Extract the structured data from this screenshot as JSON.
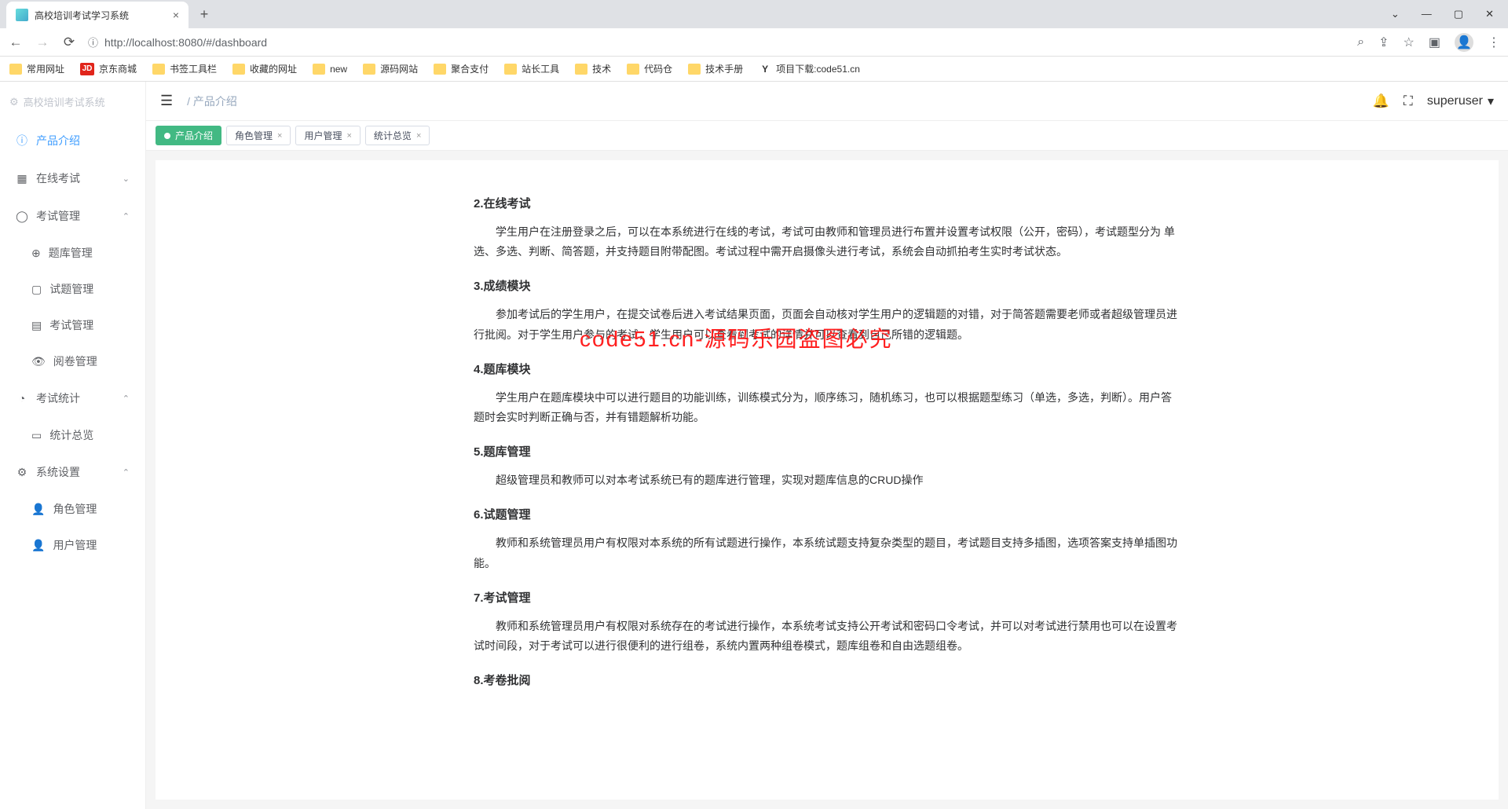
{
  "browser": {
    "tab_title": "高校培训考试学习系统",
    "url": "http://localhost:8080/#/dashboard",
    "bookmarks": [
      {
        "label": "常用网址",
        "type": "folder"
      },
      {
        "label": "京东商城",
        "type": "jd"
      },
      {
        "label": "书签工具栏",
        "type": "folder"
      },
      {
        "label": "收藏的网址",
        "type": "folder"
      },
      {
        "label": "new",
        "type": "folder"
      },
      {
        "label": "源码网站",
        "type": "folder"
      },
      {
        "label": "聚合支付",
        "type": "folder"
      },
      {
        "label": "站长工具",
        "type": "folder"
      },
      {
        "label": "技术",
        "type": "folder"
      },
      {
        "label": "代码仓",
        "type": "folder"
      },
      {
        "label": "技术手册",
        "type": "folder"
      },
      {
        "label": "项目下载:code51.cn",
        "type": "y"
      }
    ]
  },
  "sidebar": {
    "title": "高校培训考试系统",
    "items": [
      {
        "label": "产品介绍",
        "active": true
      },
      {
        "label": "在线考试",
        "expandable": true,
        "expanded": false
      },
      {
        "label": "考试管理",
        "expandable": true,
        "expanded": true,
        "children": [
          {
            "label": "题库管理"
          },
          {
            "label": "试题管理"
          },
          {
            "label": "考试管理"
          },
          {
            "label": "阅卷管理"
          }
        ]
      },
      {
        "label": "考试统计",
        "expandable": true,
        "expanded": true,
        "children": [
          {
            "label": "统计总览"
          }
        ]
      },
      {
        "label": "系统设置",
        "expandable": true,
        "expanded": true,
        "children": [
          {
            "label": "角色管理"
          },
          {
            "label": "用户管理"
          }
        ]
      }
    ]
  },
  "topbar": {
    "breadcrumb": "/  产品介绍",
    "username": "superuser"
  },
  "tabs": [
    {
      "label": "产品介绍",
      "active": true
    },
    {
      "label": "角色管理"
    },
    {
      "label": "用户管理"
    },
    {
      "label": "统计总览"
    }
  ],
  "doc": {
    "s2_h": "2.在线考试",
    "s2_p": "学生用户在注册登录之后，可以在本系统进行在线的考试，考试可由教师和管理员进行布置并设置考试权限（公开，密码），考试题型分为 单选、多选、判断、简答题，并支持题目附带配图。考试过程中需开启摄像头进行考试，系统会自动抓拍考生实时考试状态。",
    "s3_h": "3.成绩模块",
    "s3_p": "参加考试后的学生用户，在提交试卷后进入考试结果页面，页面会自动核对学生用户的逻辑题的对错，对于简答题需要老师或者超级管理员进行批阅。对于学生用户参与的考试，学生用户可以查看到考试的详情并可以查看到自己所错的逻辑题。",
    "s4_h": "4.题库模块",
    "s4_p": "学生用户在题库模块中可以进行题目的功能训练，训练模式分为，顺序练习，随机练习，也可以根据题型练习（单选，多选，判断）。用户答题时会实时判断正确与否，并有错题解析功能。",
    "s5_h": "5.题库管理",
    "s5_p": "超级管理员和教师可以对本考试系统已有的题库进行管理，实现对题库信息的CRUD操作",
    "s6_h": "6.试题管理",
    "s6_p": "教师和系统管理员用户有权限对本系统的所有试题进行操作，本系统试题支持复杂类型的题目，考试题目支持多插图，选项答案支持单插图功能。",
    "s7_h": "7.考试管理",
    "s7_p": "教师和系统管理员用户有权限对系统存在的考试进行操作，本系统考试支持公开考试和密码口令考试，并可以对考试进行禁用也可以在设置考试时间段，对于考试可以进行很便利的进行组卷，系统内置两种组卷模式，题库组卷和自由选题组卷。",
    "s8_h": "8.考卷批阅"
  },
  "watermark": "code51.cn-源码乐园盗图必究"
}
